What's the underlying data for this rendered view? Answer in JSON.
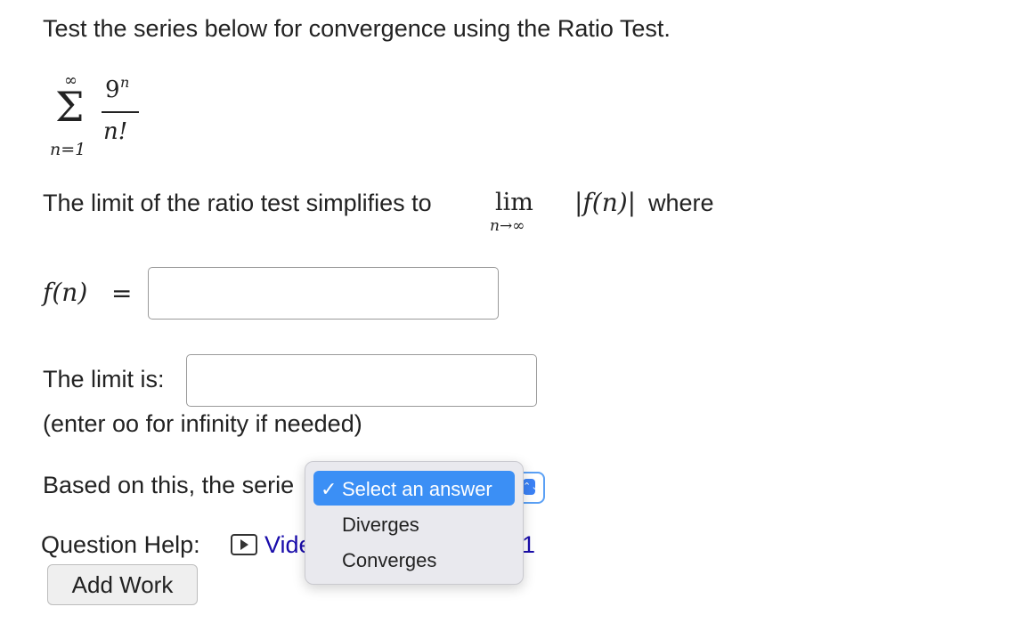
{
  "question": {
    "prompt": "Test the series below for convergence using the Ratio Test.",
    "series": {
      "upper_limit": "∞",
      "sigma": "Σ",
      "numerator_base": "9",
      "numerator_exponent": "n",
      "denominator": "n!",
      "lower_limit": "n=1"
    },
    "limit_sentence": {
      "lead": "The limit of the ratio test simplifies to",
      "lim": "lim",
      "lim_sub": "n→∞",
      "abs_expr": "|f(n)|",
      "trail": "where"
    },
    "fn_label": "f(n)",
    "equals": "=",
    "fn_input_value": "",
    "limit_label": "The limit is:",
    "limit_input_value": "",
    "limit_hint": "(enter oo for infinity if needed)",
    "based_on_text": "Based on this, the serie",
    "select": {
      "options": [
        "Select an answer",
        "Diverges",
        "Converges"
      ],
      "selected_marker": "✓",
      "arrow_glyph": "⌃⌄"
    },
    "help": {
      "label": "Question Help:",
      "video_link": "Vide",
      "trailing_fragment": "1"
    },
    "add_work_label": "Add Work"
  },
  "colors": {
    "accent_blue": "#3b8ff5",
    "link_blue": "#1a0dab",
    "dropdown_bg": "#e9e9ee"
  }
}
